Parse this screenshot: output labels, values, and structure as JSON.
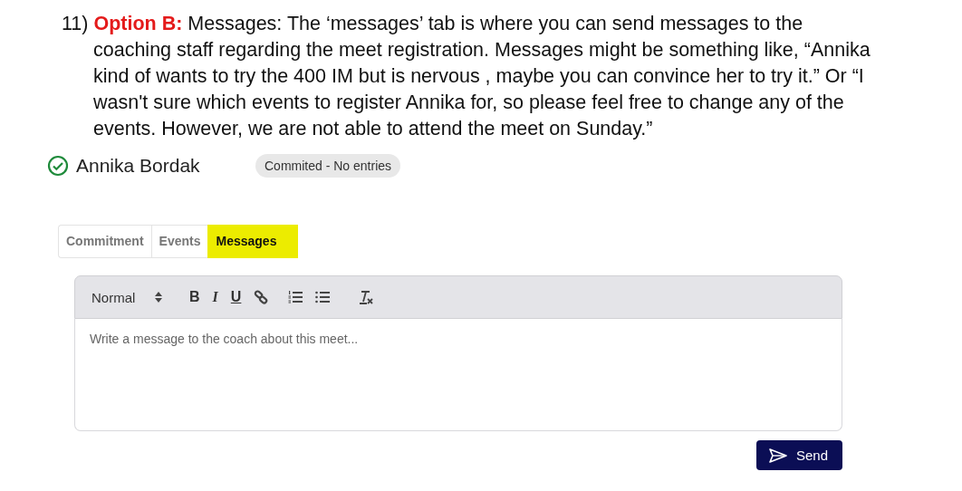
{
  "instruction": "11) **Option B:** Messages: The ‘messages’ tab is where you can send messages to the coaching staff regarding the meet registration. Messages might be something like, “Annika kind of wants to try the 400 IM but is nervous , maybe you can convince her to try it.” Or “I wasn't sure which events to register Annika for, so please feel free to change any of the events. However, we are not able to attend the meet on Sunday.”",
  "swimmer": {
    "name": "Annika Bordak",
    "status": "Commited - No entries"
  },
  "tabs": [
    {
      "label": "Commitment",
      "selected": false
    },
    {
      "label": "Events",
      "selected": false
    },
    {
      "label": "Messages",
      "selected": true
    }
  ],
  "editor": {
    "format": "Normal",
    "bold": "B",
    "italic": "I",
    "underline": "U",
    "placeholder": "Write a message to the coach about this meet..."
  },
  "send_button": "Send"
}
